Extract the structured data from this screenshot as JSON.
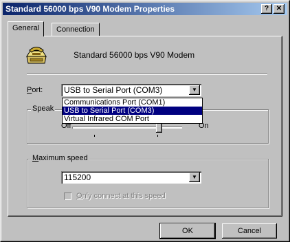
{
  "window": {
    "title": "Standard 56000 bps V90 Modem Properties",
    "help_label": "?",
    "close_label": "✕"
  },
  "tabs": [
    {
      "label": "General",
      "active": true
    },
    {
      "label": "Connection",
      "active": false
    }
  ],
  "device": {
    "name": "Standard 56000 bps V90 Modem",
    "icon": "modem-phone-icon"
  },
  "port": {
    "label_prefix": "P",
    "label_rest": "ort:",
    "value": "USB to Serial Port (COM3)",
    "options": [
      "Communications Port (COM1)",
      "USB to Serial Port (COM3)",
      "Virtual Infrared COM Port"
    ],
    "selected_index": 1
  },
  "speaker": {
    "legend": "Speak",
    "off_label": "Off",
    "on_label": "On",
    "level_fraction": 0.8
  },
  "max_speed": {
    "legend_prefix": "M",
    "legend_rest": "aximum speed",
    "value": "115200",
    "only_connect_prefix": "O",
    "only_connect_rest": "nly connect at this speed",
    "only_connect_checked": false
  },
  "buttons": {
    "ok": "OK",
    "cancel": "Cancel"
  },
  "colors": {
    "titlebar_start": "#0a246a",
    "titlebar_end": "#a6caf0",
    "selection": "#000080"
  }
}
